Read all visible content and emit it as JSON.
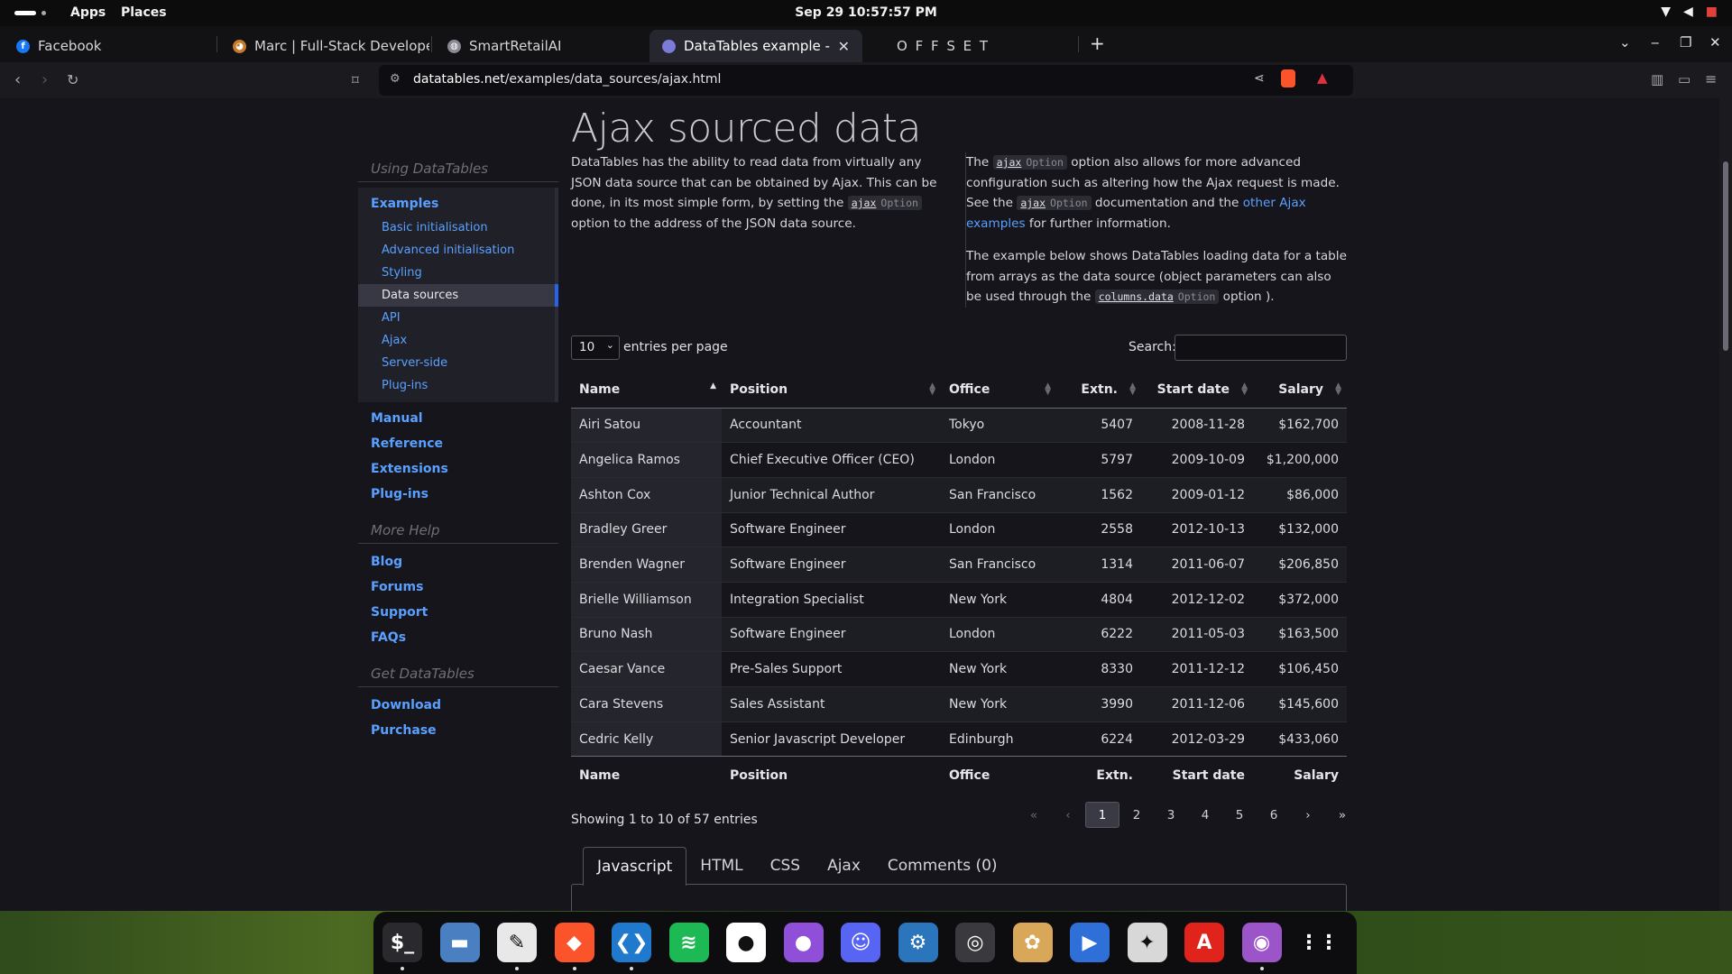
{
  "topbar": {
    "apps": "Apps",
    "places": "Places",
    "clock": "Sep 29  10:57:57 PM"
  },
  "tabs": [
    {
      "label": "Facebook",
      "icon": "facebook-icon",
      "color": "#1877f2"
    },
    {
      "label": "Marc | Full-Stack Developer",
      "icon": "avatar-icon",
      "color": "#c77b2a"
    },
    {
      "label": "SmartRetailAI",
      "icon": "globe-icon",
      "color": "#8a8a94"
    },
    {
      "label": "DataTables example - Aj",
      "icon": "datatables-icon",
      "color": "#7b7bd8"
    },
    {
      "label": "O F F S E T",
      "icon": "",
      "color": ""
    }
  ],
  "url": {
    "domain": "datatables.net",
    "path": "/examples/data_sources/ajax.html"
  },
  "sidebar": {
    "using_head": "Using DataTables",
    "examples": "Examples",
    "sub": [
      "Basic initialisation",
      "Advanced initialisation",
      "Styling",
      "Data sources",
      "API",
      "Ajax",
      "Server-side",
      "Plug-ins"
    ],
    "links1": [
      "Manual",
      "Reference",
      "Extensions",
      "Plug-ins"
    ],
    "more_head": "More Help",
    "links2": [
      "Blog",
      "Forums",
      "Support",
      "FAQs"
    ],
    "get_head": "Get DataTables",
    "links3": [
      "Download",
      "Purchase"
    ]
  },
  "page": {
    "title": "Ajax sourced data",
    "p1a": "DataTables has the ability to read data from virtually any JSON data source that can be obtained by Ajax. This can be done, in its most simple form, by setting the",
    "p1b": "option to the address of the JSON data source.",
    "p2a": "The",
    "p2b": "option also allows for more advanced configuration such as altering how the Ajax request is made. See the",
    "p2c": "documentation and the",
    "p2link": "other Ajax examples",
    "p2d": "for further information.",
    "p3a": "The example below shows DataTables loading data for a table from arrays as the data source (object parameters can also be used through the",
    "p3b": "option ).",
    "code_ajax": "ajax",
    "code_option": "Option",
    "code_columns": "columns.data"
  },
  "controls": {
    "length": "10",
    "length_label": "entries per page",
    "search_label": "Search:"
  },
  "table": {
    "headers": [
      "Name",
      "Position",
      "Office",
      "Extn.",
      "Start date",
      "Salary"
    ],
    "rows": [
      [
        "Airi Satou",
        "Accountant",
        "Tokyo",
        "5407",
        "2008-11-28",
        "$162,700"
      ],
      [
        "Angelica Ramos",
        "Chief Executive Officer (CEO)",
        "London",
        "5797",
        "2009-10-09",
        "$1,200,000"
      ],
      [
        "Ashton Cox",
        "Junior Technical Author",
        "San Francisco",
        "1562",
        "2009-01-12",
        "$86,000"
      ],
      [
        "Bradley Greer",
        "Software Engineer",
        "London",
        "2558",
        "2012-10-13",
        "$132,000"
      ],
      [
        "Brenden Wagner",
        "Software Engineer",
        "San Francisco",
        "1314",
        "2011-06-07",
        "$206,850"
      ],
      [
        "Brielle Williamson",
        "Integration Specialist",
        "New York",
        "4804",
        "2012-12-02",
        "$372,000"
      ],
      [
        "Bruno Nash",
        "Software Engineer",
        "London",
        "6222",
        "2011-05-03",
        "$163,500"
      ],
      [
        "Caesar Vance",
        "Pre-Sales Support",
        "New York",
        "8330",
        "2011-12-12",
        "$106,450"
      ],
      [
        "Cara Stevens",
        "Sales Assistant",
        "New York",
        "3990",
        "2011-12-06",
        "$145,600"
      ],
      [
        "Cedric Kelly",
        "Senior Javascript Developer",
        "Edinburgh",
        "6224",
        "2012-03-29",
        "$433,060"
      ]
    ]
  },
  "info": "Showing 1 to 10 of 57 entries",
  "pager": [
    "«",
    "‹",
    "1",
    "2",
    "3",
    "4",
    "5",
    "6",
    "›",
    "»"
  ],
  "code_tabs": [
    "Javascript",
    "HTML",
    "CSS",
    "Ajax",
    "Comments (0)"
  ],
  "dock": [
    {
      "name": "terminal-icon",
      "glyph": "$_",
      "color": "#2a2a2e"
    },
    {
      "name": "files-icon",
      "glyph": "▬",
      "color": "#4a7fc1"
    },
    {
      "name": "text-editor-icon",
      "glyph": "✎",
      "color": "#e8e8e8"
    },
    {
      "name": "brave-icon",
      "glyph": "◆",
      "color": "#fb542b"
    },
    {
      "name": "vscode-icon",
      "glyph": "❮❯",
      "color": "#1f7acd"
    },
    {
      "name": "spotify-icon",
      "glyph": "≋",
      "color": "#1db954"
    },
    {
      "name": "github-icon",
      "glyph": "●",
      "color": "#ffffff"
    },
    {
      "name": "github-desktop-icon",
      "glyph": "●",
      "color": "#8f4fd8"
    },
    {
      "name": "discord-icon",
      "glyph": "☺",
      "color": "#5865f2"
    },
    {
      "name": "steam-icon",
      "glyph": "⚙",
      "color": "#2a75bb"
    },
    {
      "name": "obs-icon",
      "glyph": "◎",
      "color": "#3a3a3e"
    },
    {
      "name": "game-icon",
      "glyph": "✿",
      "color": "#d9a75a"
    },
    {
      "name": "remote-desktop-icon",
      "glyph": "▶",
      "color": "#2f6fd8"
    },
    {
      "name": "tool-icon",
      "glyph": "✦",
      "color": "#d8d8d8"
    },
    {
      "name": "pdf-icon",
      "glyph": "A",
      "color": "#e0241b"
    },
    {
      "name": "audio-icon",
      "glyph": "◉",
      "color": "#9b55c8"
    },
    {
      "name": "app-grid-icon",
      "glyph": "⋮⋮",
      "color": "#0d0d10"
    }
  ]
}
